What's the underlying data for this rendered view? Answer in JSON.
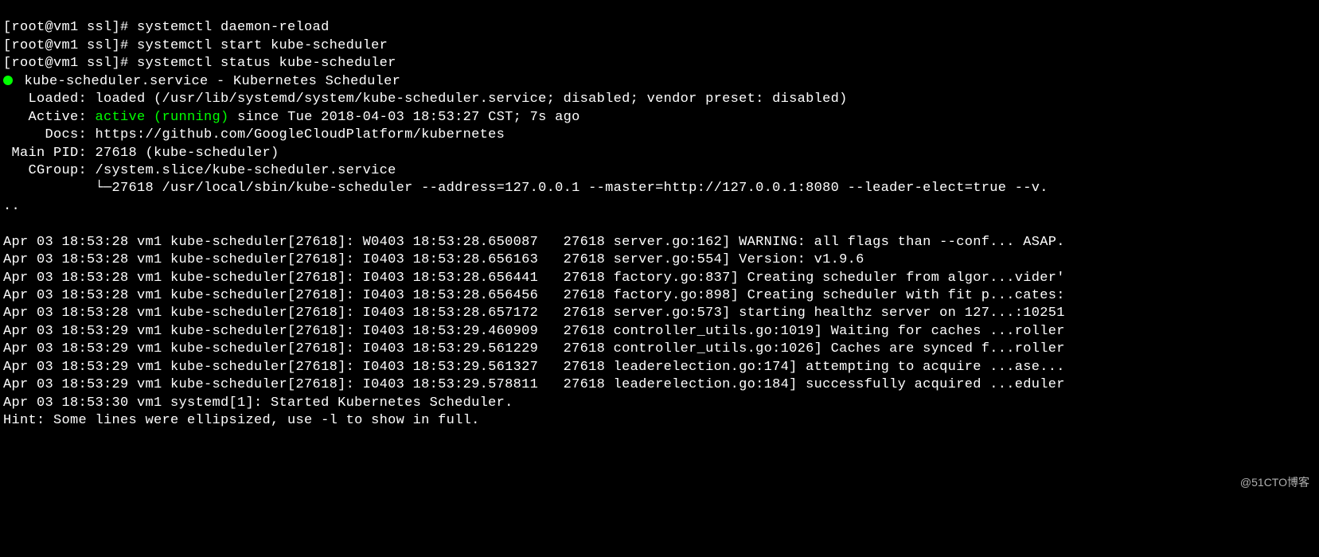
{
  "commands": [
    "[root@vm1 ssl]# systemctl daemon-reload",
    "[root@vm1 ssl]# systemctl start kube-scheduler",
    "[root@vm1 ssl]# systemctl status kube-scheduler"
  ],
  "status": {
    "service_line": "kube-scheduler.service - Kubernetes Scheduler",
    "loaded": "   Loaded: loaded (/usr/lib/systemd/system/kube-scheduler.service; disabled; vendor preset: disabled)",
    "active_label": "   Active: ",
    "active_state": "active (running)",
    "active_since": " since Tue 2018-04-03 18:53:27 CST; 7s ago",
    "docs": "     Docs: https://github.com/GoogleCloudPlatform/kubernetes",
    "main_pid": " Main PID: 27618 (kube-scheduler)",
    "cgroup": "   CGroup: /system.slice/kube-scheduler.service",
    "cgroup_child": "           └─27618 /usr/local/sbin/kube-scheduler --address=127.0.0.1 --master=http://127.0.0.1:8080 --leader-elect=true --v.",
    "continuation": ".."
  },
  "logs": [
    "Apr 03 18:53:28 vm1 kube-scheduler[27618]: W0403 18:53:28.650087   27618 server.go:162] WARNING: all flags than --conf... ASAP.",
    "Apr 03 18:53:28 vm1 kube-scheduler[27618]: I0403 18:53:28.656163   27618 server.go:554] Version: v1.9.6",
    "Apr 03 18:53:28 vm1 kube-scheduler[27618]: I0403 18:53:28.656441   27618 factory.go:837] Creating scheduler from algor...vider'",
    "Apr 03 18:53:28 vm1 kube-scheduler[27618]: I0403 18:53:28.656456   27618 factory.go:898] Creating scheduler with fit p...cates:",
    "Apr 03 18:53:28 vm1 kube-scheduler[27618]: I0403 18:53:28.657172   27618 server.go:573] starting healthz server on 127...:10251",
    "Apr 03 18:53:29 vm1 kube-scheduler[27618]: I0403 18:53:29.460909   27618 controller_utils.go:1019] Waiting for caches ...roller",
    "Apr 03 18:53:29 vm1 kube-scheduler[27618]: I0403 18:53:29.561229   27618 controller_utils.go:1026] Caches are synced f...roller",
    "Apr 03 18:53:29 vm1 kube-scheduler[27618]: I0403 18:53:29.561327   27618 leaderelection.go:174] attempting to acquire ...ase...",
    "Apr 03 18:53:29 vm1 kube-scheduler[27618]: I0403 18:53:29.578811   27618 leaderelection.go:184] successfully acquired ...eduler",
    "Apr 03 18:53:30 vm1 systemd[1]: Started Kubernetes Scheduler."
  ],
  "hint": "Hint: Some lines were ellipsized, use -l to show in full.",
  "watermark": "@51CTO博客"
}
